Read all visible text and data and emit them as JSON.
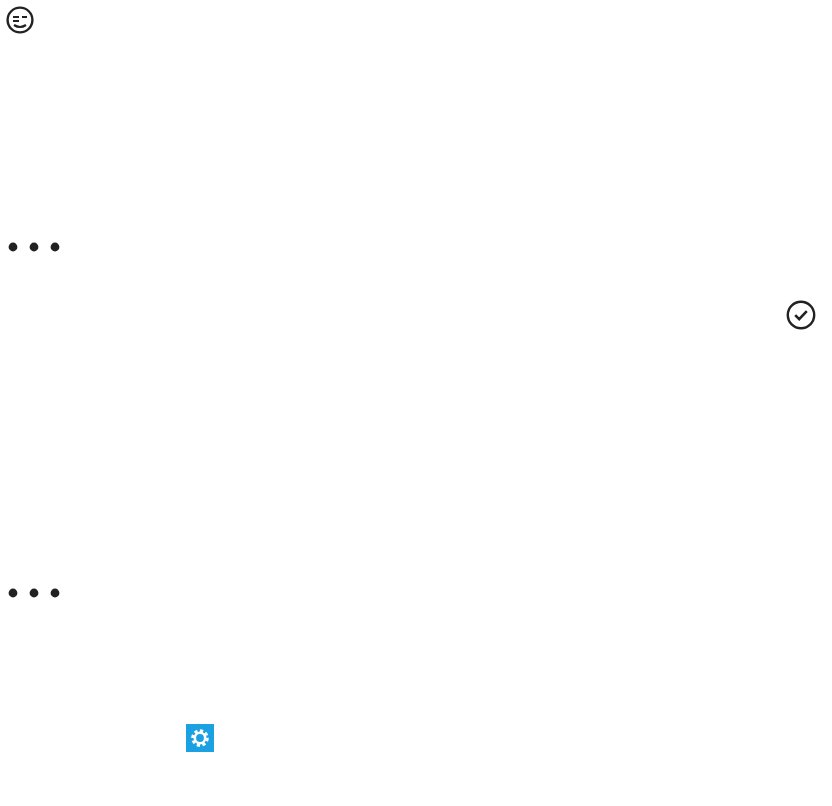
{
  "icons": [
    {
      "kind": "emoji"
    },
    {
      "kind": "more"
    },
    {
      "kind": "check"
    },
    {
      "kind": "more"
    },
    {
      "kind": "settings"
    }
  ]
}
